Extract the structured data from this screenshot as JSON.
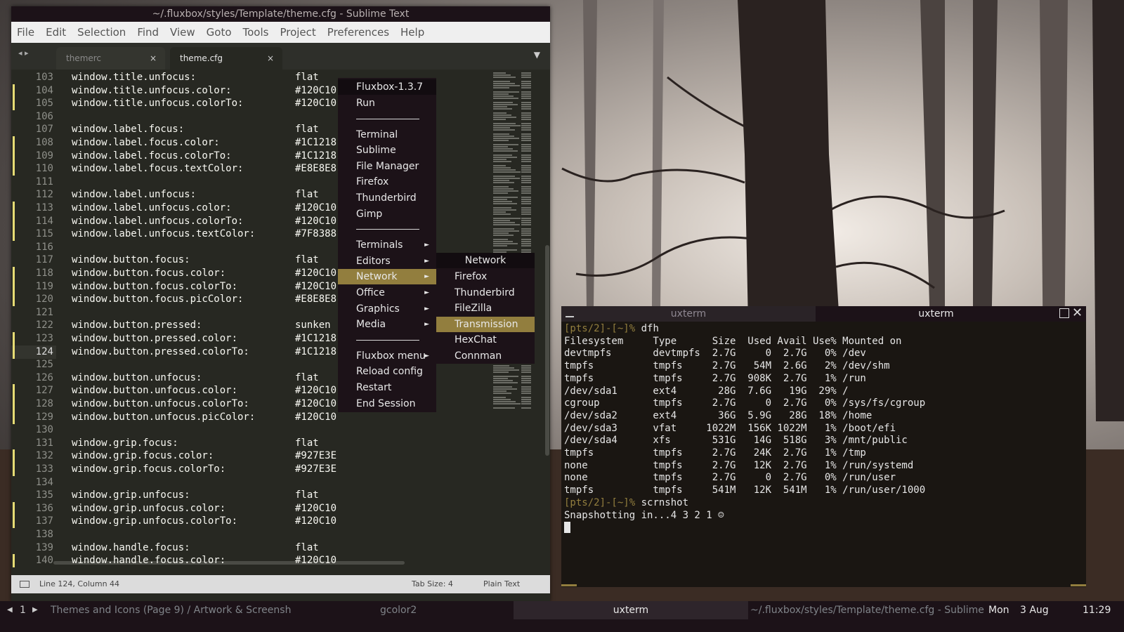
{
  "sublime": {
    "title": "~/.fluxbox/styles/Template/theme.cfg - Sublime Text",
    "menu": [
      "File",
      "Edit",
      "Selection",
      "Find",
      "View",
      "Goto",
      "Tools",
      "Project",
      "Preferences",
      "Help"
    ],
    "tabs": [
      {
        "label": "themerc",
        "active": false,
        "close": "×"
      },
      {
        "label": "theme.cfg",
        "active": true,
        "close": "×"
      }
    ],
    "tab_nav": "◂ ▸",
    "tab_dropdown": "▼",
    "lines": [
      {
        "n": "103",
        "key": "window.title.unfocus:",
        "val": "flat",
        "mark": false
      },
      {
        "n": "104",
        "key": "window.title.unfocus.color:",
        "val": "#120C10",
        "mark": true
      },
      {
        "n": "105",
        "key": "window.title.unfocus.colorTo:",
        "val": "#120C10",
        "mark": true
      },
      {
        "n": "106",
        "key": "",
        "val": "",
        "mark": false
      },
      {
        "n": "107",
        "key": "window.label.focus:",
        "val": "flat",
        "mark": false
      },
      {
        "n": "108",
        "key": "window.label.focus.color:",
        "val": "#1C1218",
        "mark": true
      },
      {
        "n": "109",
        "key": "window.label.focus.colorTo:",
        "val": "#1C1218",
        "mark": true
      },
      {
        "n": "110",
        "key": "window.label.focus.textColor:",
        "val": "#E8E8E8",
        "mark": true
      },
      {
        "n": "111",
        "key": "",
        "val": "",
        "mark": false
      },
      {
        "n": "112",
        "key": "window.label.unfocus:",
        "val": "flat",
        "mark": false
      },
      {
        "n": "113",
        "key": "window.label.unfocus.color:",
        "val": "#120C10",
        "mark": true
      },
      {
        "n": "114",
        "key": "window.label.unfocus.colorTo:",
        "val": "#120C10",
        "mark": true
      },
      {
        "n": "115",
        "key": "window.label.unfocus.textColor:",
        "val": "#7F8388",
        "mark": true
      },
      {
        "n": "116",
        "key": "",
        "val": "",
        "mark": false
      },
      {
        "n": "117",
        "key": "window.button.focus:",
        "val": "flat",
        "mark": false
      },
      {
        "n": "118",
        "key": "window.button.focus.color:",
        "val": "#120C10",
        "mark": true
      },
      {
        "n": "119",
        "key": "window.button.focus.colorTo:",
        "val": "#120C10",
        "mark": true
      },
      {
        "n": "120",
        "key": "window.button.focus.picColor:",
        "val": "#E8E8E8",
        "mark": true
      },
      {
        "n": "121",
        "key": "",
        "val": "",
        "mark": false
      },
      {
        "n": "122",
        "key": "window.button.pressed:",
        "val": "sunken",
        "mark": false
      },
      {
        "n": "123",
        "key": "window.button.pressed.color:",
        "val": "#1C1218",
        "mark": true
      },
      {
        "n": "124",
        "key": "window.button.pressed.colorTo:",
        "val": "#1C1218",
        "mark": true
      },
      {
        "n": "125",
        "key": "",
        "val": "",
        "mark": false
      },
      {
        "n": "126",
        "key": "window.button.unfocus:",
        "val": "flat",
        "mark": false
      },
      {
        "n": "127",
        "key": "window.button.unfocus.color:",
        "val": "#120C10",
        "mark": true
      },
      {
        "n": "128",
        "key": "window.button.unfocus.colorTo:",
        "val": "#120C10",
        "mark": true
      },
      {
        "n": "129",
        "key": "window.button.unfocus.picColor:",
        "val": "#120C10",
        "mark": true
      },
      {
        "n": "130",
        "key": "",
        "val": "",
        "mark": false
      },
      {
        "n": "131",
        "key": "window.grip.focus:",
        "val": "flat",
        "mark": false
      },
      {
        "n": "132",
        "key": "window.grip.focus.color:",
        "val": "#927E3E",
        "mark": true
      },
      {
        "n": "133",
        "key": "window.grip.focus.colorTo:",
        "val": "#927E3E",
        "mark": true
      },
      {
        "n": "134",
        "key": "",
        "val": "",
        "mark": false
      },
      {
        "n": "135",
        "key": "window.grip.unfocus:",
        "val": "flat",
        "mark": false
      },
      {
        "n": "136",
        "key": "window.grip.unfocus.color:",
        "val": "#120C10",
        "mark": true
      },
      {
        "n": "137",
        "key": "window.grip.unfocus.colorTo:",
        "val": "#120C10",
        "mark": true
      },
      {
        "n": "138",
        "key": "",
        "val": "",
        "mark": false
      },
      {
        "n": "139",
        "key": "window.handle.focus:",
        "val": "flat",
        "mark": false
      },
      {
        "n": "140",
        "key": "window.handle.focus.color:",
        "val": "#120C10",
        "mark": true
      }
    ],
    "current_line": "124",
    "status": {
      "position": "Line 124, Column 44",
      "tab_size": "Tab Size: 4",
      "syntax": "Plain Text"
    }
  },
  "rootmenu": {
    "title": "Fluxbox-1.3.7",
    "groups": [
      [
        "Run"
      ],
      [
        "Terminal",
        "Sublime",
        "File Manager",
        "Firefox",
        "Thunderbird",
        "Gimp"
      ],
      [
        "Terminals",
        "Editors",
        "Network",
        "Office",
        "Graphics",
        "Media"
      ],
      [
        "Fluxbox menu",
        "Reload config",
        "Restart",
        "End Session"
      ]
    ],
    "submenu_items": [
      "Terminals",
      "Editors",
      "Network",
      "Office",
      "Graphics",
      "Media",
      "Fluxbox menu"
    ],
    "highlighted": "Network",
    "arrow": "►"
  },
  "network_menu": {
    "title": "Network",
    "items": [
      "Firefox",
      "Thunderbird",
      "FileZilla",
      "Transmission",
      "HexChat",
      "Connman"
    ],
    "highlighted": "Transmission"
  },
  "uxterm": {
    "tabs": [
      "uxterm",
      "uxterm"
    ],
    "close": "✕",
    "lines": [
      {
        "prompt": "[pts/2]-[~]%",
        "cmd": " dfh"
      },
      {
        "text": "Filesystem     Type      Size  Used Avail Use% Mounted on"
      },
      {
        "text": "devtmpfs       devtmpfs  2.7G     0  2.7G   0% /dev"
      },
      {
        "text": "tmpfs          tmpfs     2.7G   54M  2.6G   2% /dev/shm"
      },
      {
        "text": "tmpfs          tmpfs     2.7G  908K  2.7G   1% /run"
      },
      {
        "text": "/dev/sda1      ext4       28G  7.6G   19G  29% /"
      },
      {
        "text": "cgroup         tmpfs     2.7G     0  2.7G   0% /sys/fs/cgroup"
      },
      {
        "text": "/dev/sda2      ext4       36G  5.9G   28G  18% /home"
      },
      {
        "text": "/dev/sda3      vfat     1022M  156K 1022M   1% /boot/efi"
      },
      {
        "text": "/dev/sda4      xfs       531G   14G  518G   3% /mnt/public"
      },
      {
        "text": "tmpfs          tmpfs     2.7G   24K  2.7G   1% /tmp"
      },
      {
        "text": "none           tmpfs     2.7G   12K  2.7G   1% /run/systemd"
      },
      {
        "text": "none           tmpfs     2.7G     0  2.7G   0% /run/user"
      },
      {
        "text": "tmpfs          tmpfs     541M   12K  541M   1% /run/user/1000"
      },
      {
        "prompt": "[pts/2]-[~]%",
        "cmd": " scrnshot"
      },
      {
        "text": "Snapshotting in...4 3 2 1 ☺"
      }
    ]
  },
  "toolbar": {
    "ws_prev": "◀",
    "workspace": "1",
    "ws_next": "▶",
    "tasks": [
      {
        "label": "Themes and Icons (Page 9) / Artwork & Screensh",
        "focused": false
      },
      {
        "label": "gcolor2",
        "focused": false
      },
      {
        "label": "uxterm",
        "focused": true
      },
      {
        "label": "~/.fluxbox/styles/Template/theme.cfg - Sublime",
        "focused": false
      }
    ],
    "clock_day": "Mon",
    "clock_date": "3 Aug",
    "clock_time": "11:29"
  },
  "colors": {
    "accent": "#927E3E",
    "menu_bg": "#1C1218",
    "title_unfocus": "#120C10",
    "text": "#E8E8E8",
    "muted": "#7F8388"
  }
}
